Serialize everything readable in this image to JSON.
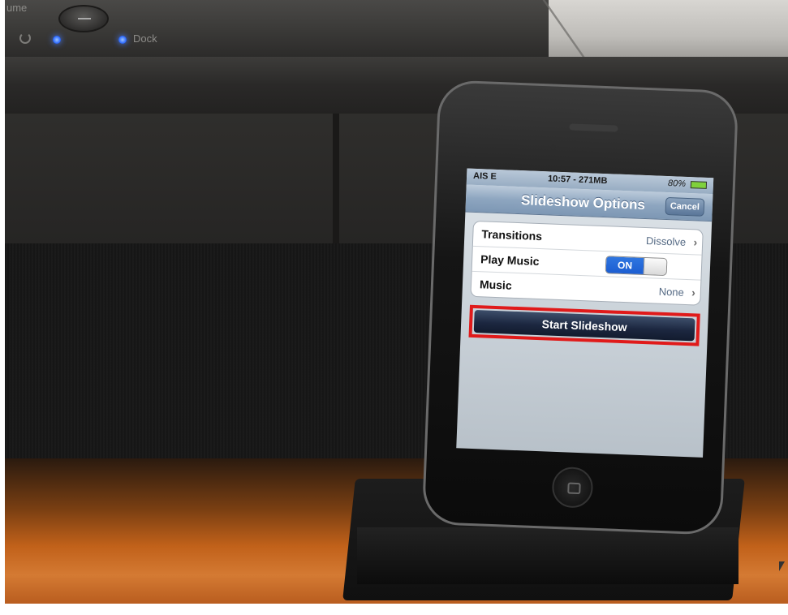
{
  "background": {
    "speaker_labels": {
      "volume_partial": "ume",
      "dock": "Dock"
    }
  },
  "phone": {
    "status_bar": {
      "carrier": "AIS E",
      "time_memory": "10:57 - 271MB",
      "battery": "80%"
    },
    "nav_bar": {
      "title": "Slideshow Options",
      "cancel_label": "Cancel"
    },
    "settings": {
      "rows": [
        {
          "label": "Transitions",
          "value": "Dissolve"
        },
        {
          "label": "Play Music",
          "toggle": "ON"
        },
        {
          "label": "Music",
          "value": "None"
        }
      ]
    },
    "start_button": {
      "label": "Start Slideshow",
      "highlight_color": "#e01a1a"
    }
  },
  "colors": {
    "led_blue": "#2f6cff",
    "nav_blue": "#7d97b4",
    "switch_blue": "#1a5bd0"
  }
}
